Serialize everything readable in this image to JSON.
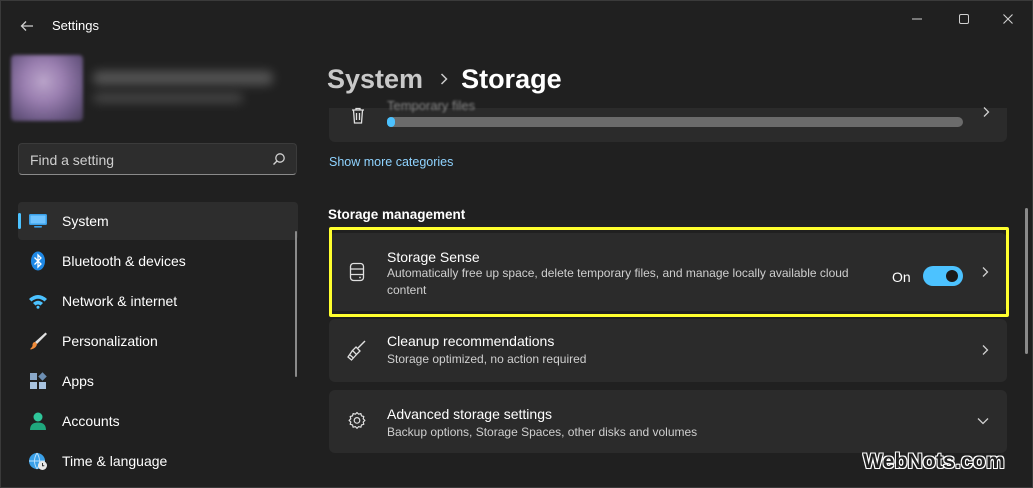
{
  "window": {
    "title": "Settings",
    "controls": [
      "minimize",
      "maximize",
      "close"
    ]
  },
  "search": {
    "placeholder": "Find a setting"
  },
  "sidebar": {
    "items": [
      {
        "label": "System",
        "icon": "system-monitor-icon",
        "active": true
      },
      {
        "label": "Bluetooth & devices",
        "icon": "bluetooth-icon",
        "active": false
      },
      {
        "label": "Network & internet",
        "icon": "wifi-icon",
        "active": false
      },
      {
        "label": "Personalization",
        "icon": "paintbrush-icon",
        "active": false
      },
      {
        "label": "Apps",
        "icon": "apps-icon",
        "active": false
      },
      {
        "label": "Accounts",
        "icon": "account-icon",
        "active": false
      },
      {
        "label": "Time & language",
        "icon": "globe-clock-icon",
        "active": false
      }
    ]
  },
  "breadcrumb": {
    "parent": "System",
    "current": "Storage"
  },
  "storage_category": {
    "label": "Temporary files",
    "usage_fraction": 0.01
  },
  "show_more": "Show more categories",
  "section_title": "Storage management",
  "cards": {
    "storage_sense": {
      "title": "Storage Sense",
      "description": "Automatically free up space, delete temporary files, and manage locally available cloud content",
      "toggle_label": "On",
      "toggle_on": true
    },
    "cleanup": {
      "title": "Cleanup recommendations",
      "description": "Storage optimized, no action required"
    },
    "advanced": {
      "title": "Advanced storage settings",
      "description": "Backup options, Storage Spaces, other disks and volumes"
    }
  },
  "watermark": "WebNots.com",
  "colors": {
    "accent": "#4cc2ff",
    "highlight": "#ffff2e",
    "background": "#202020",
    "card": "#2b2b2b"
  }
}
